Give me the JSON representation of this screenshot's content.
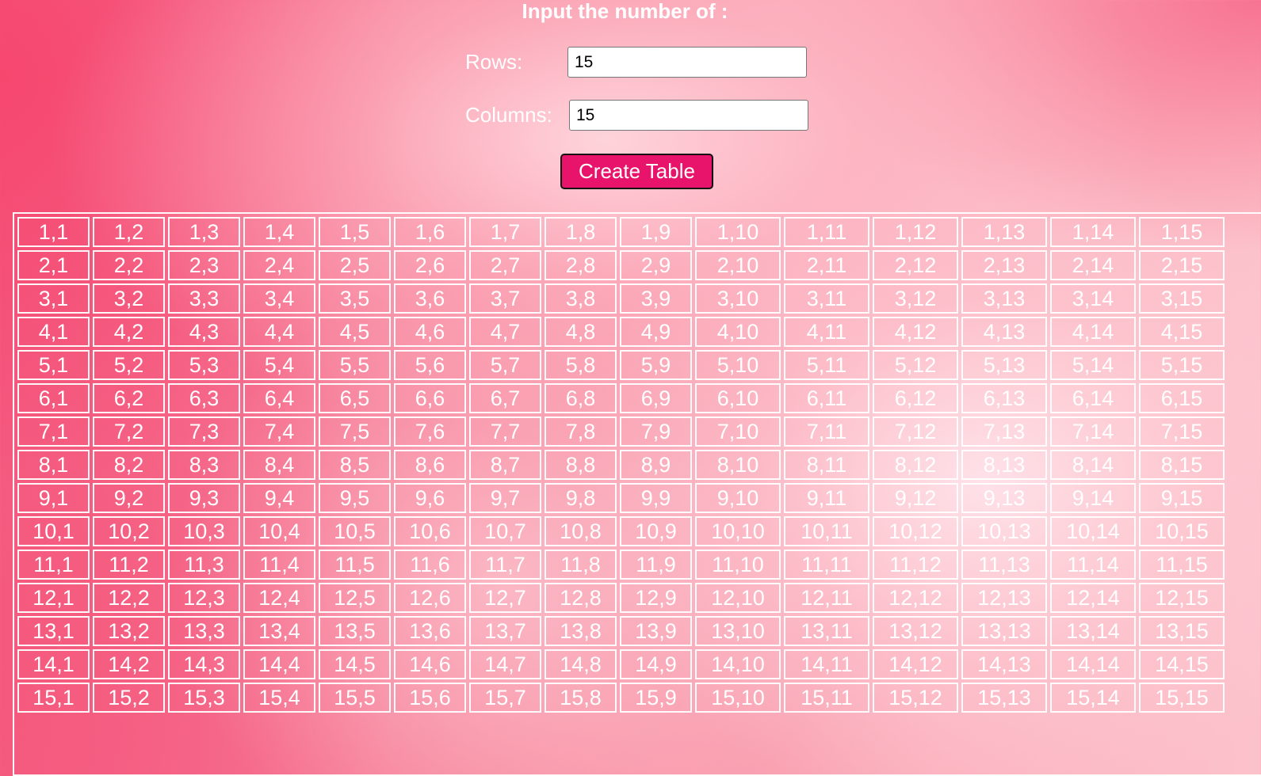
{
  "form": {
    "title": "Input the number of :",
    "rows_label": "Rows:",
    "rows_value": "15",
    "columns_label": "Columns:",
    "columns_value": "15",
    "create_button_label": "Create Table"
  },
  "table": {
    "rows": [
      [
        "1,1",
        "1,2",
        "1,3",
        "1,4",
        "1,5",
        "1,6",
        "1,7",
        "1,8",
        "1,9",
        "1,10",
        "1,11",
        "1,12",
        "1,13",
        "1,14",
        "1,15"
      ],
      [
        "2,1",
        "2,2",
        "2,3",
        "2,4",
        "2,5",
        "2,6",
        "2,7",
        "2,8",
        "2,9",
        "2,10",
        "2,11",
        "2,12",
        "2,13",
        "2,14",
        "2,15"
      ],
      [
        "3,1",
        "3,2",
        "3,3",
        "3,4",
        "3,5",
        "3,6",
        "3,7",
        "3,8",
        "3,9",
        "3,10",
        "3,11",
        "3,12",
        "3,13",
        "3,14",
        "3,15"
      ],
      [
        "4,1",
        "4,2",
        "4,3",
        "4,4",
        "4,5",
        "4,6",
        "4,7",
        "4,8",
        "4,9",
        "4,10",
        "4,11",
        "4,12",
        "4,13",
        "4,14",
        "4,15"
      ],
      [
        "5,1",
        "5,2",
        "5,3",
        "5,4",
        "5,5",
        "5,6",
        "5,7",
        "5,8",
        "5,9",
        "5,10",
        "5,11",
        "5,12",
        "5,13",
        "5,14",
        "5,15"
      ],
      [
        "6,1",
        "6,2",
        "6,3",
        "6,4",
        "6,5",
        "6,6",
        "6,7",
        "6,8",
        "6,9",
        "6,10",
        "6,11",
        "6,12",
        "6,13",
        "6,14",
        "6,15"
      ],
      [
        "7,1",
        "7,2",
        "7,3",
        "7,4",
        "7,5",
        "7,6",
        "7,7",
        "7,8",
        "7,9",
        "7,10",
        "7,11",
        "7,12",
        "7,13",
        "7,14",
        "7,15"
      ],
      [
        "8,1",
        "8,2",
        "8,3",
        "8,4",
        "8,5",
        "8,6",
        "8,7",
        "8,8",
        "8,9",
        "8,10",
        "8,11",
        "8,12",
        "8,13",
        "8,14",
        "8,15"
      ],
      [
        "9,1",
        "9,2",
        "9,3",
        "9,4",
        "9,5",
        "9,6",
        "9,7",
        "9,8",
        "9,9",
        "9,10",
        "9,11",
        "9,12",
        "9,13",
        "9,14",
        "9,15"
      ],
      [
        "10,1",
        "10,2",
        "10,3",
        "10,4",
        "10,5",
        "10,6",
        "10,7",
        "10,8",
        "10,9",
        "10,10",
        "10,11",
        "10,12",
        "10,13",
        "10,14",
        "10,15"
      ],
      [
        "11,1",
        "11,2",
        "11,3",
        "11,4",
        "11,5",
        "11,6",
        "11,7",
        "11,8",
        "11,9",
        "11,10",
        "11,11",
        "11,12",
        "11,13",
        "11,14",
        "11,15"
      ],
      [
        "12,1",
        "12,2",
        "12,3",
        "12,4",
        "12,5",
        "12,6",
        "12,7",
        "12,8",
        "12,9",
        "12,10",
        "12,11",
        "12,12",
        "12,13",
        "12,14",
        "12,15"
      ],
      [
        "13,1",
        "13,2",
        "13,3",
        "13,4",
        "13,5",
        "13,6",
        "13,7",
        "13,8",
        "13,9",
        "13,10",
        "13,11",
        "13,12",
        "13,13",
        "13,14",
        "13,15"
      ],
      [
        "14,1",
        "14,2",
        "14,3",
        "14,4",
        "14,5",
        "14,6",
        "14,7",
        "14,8",
        "14,9",
        "14,10",
        "14,11",
        "14,12",
        "14,13",
        "14,14",
        "14,15"
      ],
      [
        "15,1",
        "15,2",
        "15,3",
        "15,4",
        "15,5",
        "15,6",
        "15,7",
        "15,8",
        "15,9",
        "15,10",
        "15,11",
        "15,12",
        "15,13",
        "15,14",
        "15,15"
      ]
    ]
  },
  "colors": {
    "background_accent": "#f45a82",
    "button_background": "#e8136a",
    "text": "#ffffff"
  }
}
